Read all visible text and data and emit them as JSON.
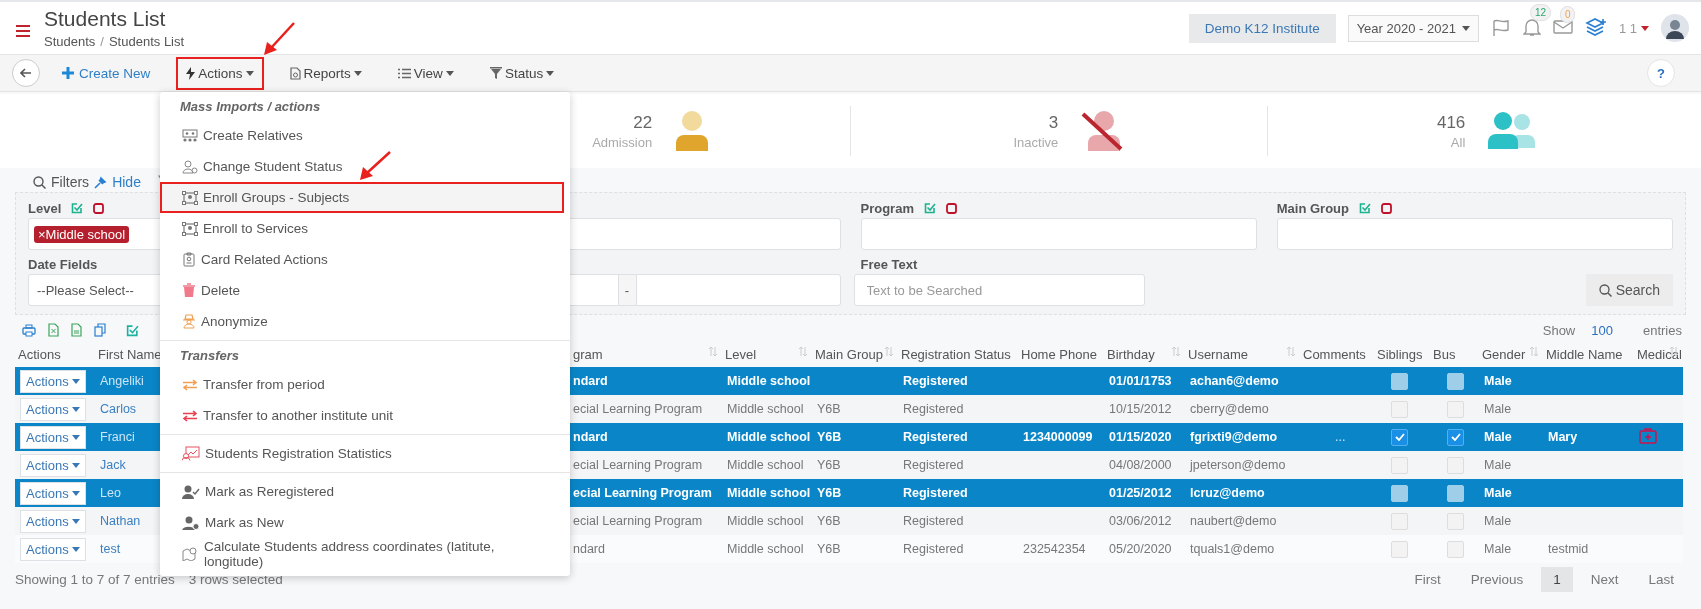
{
  "header": {
    "title": "Students List",
    "breadcrumb": [
      "Students",
      "Students List"
    ],
    "breadcrumb_separator": "/",
    "institute": "Demo K12 Institute",
    "year": "Year 2020 - 2021",
    "notifications": "12",
    "messages": "0",
    "user": "1 1"
  },
  "toolbar": {
    "items": [
      {
        "kind": "create",
        "label": "Create New",
        "marked": false
      },
      {
        "kind": "actions",
        "label": "Actions",
        "marked": true
      },
      {
        "kind": "reports",
        "label": "Reports",
        "marked": false
      },
      {
        "kind": "view",
        "label": "View",
        "marked": false
      },
      {
        "kind": "status",
        "label": "Status",
        "marked": false
      }
    ],
    "help": "?"
  },
  "stats": [
    {
      "kind": "admission",
      "value": "22",
      "label": "Admission"
    },
    {
      "kind": "inactive",
      "value": "3",
      "label": "Inactive"
    },
    {
      "kind": "all",
      "value": "416",
      "label": "All"
    }
  ],
  "filters": {
    "title": "Filters",
    "hide": "Hide",
    "level": {
      "label": "Level",
      "tag_remove": "×",
      "tag": "Middle school"
    },
    "program": {
      "label": "Program"
    },
    "main_group": {
      "label": "Main Group"
    },
    "date_fields": {
      "label": "Date Fields",
      "value": "--Please Select--"
    },
    "date_separator": "-",
    "free_text": {
      "label": "Free Text",
      "placeholder": "Text to be Searched"
    },
    "search": "Search"
  },
  "table": {
    "show": "Show",
    "page_size": "100",
    "entries": "entries",
    "columns": [
      {
        "label": "Actions",
        "sortable": false
      },
      {
        "label": "First Name"
      },
      {
        "label": "gram",
        "sortable": true
      },
      {
        "label": "Level",
        "sortable": true
      },
      {
        "label": "Main Group",
        "sortable": true
      },
      {
        "label": "Registration Status",
        "sortable": false
      },
      {
        "label": "Home Phone",
        "sortable": false
      },
      {
        "label": "Birthday",
        "sortable": true
      },
      {
        "label": "Username",
        "sortable": true
      },
      {
        "label": "Comments",
        "sortable": false
      },
      {
        "label": "Siblings",
        "sortable": false
      },
      {
        "label": "Bus",
        "sortable": false
      },
      {
        "label": "Gender",
        "sortable": true
      },
      {
        "label": "Middle Name",
        "sortable": false
      },
      {
        "label": "Medical",
        "sortable": true
      }
    ],
    "rows": [
      {
        "selected": true,
        "action": "Actions",
        "first_name": "Angeliki",
        "program": "ndard",
        "level": "Middle school",
        "status": "Registered",
        "birthday": "01/01/1753",
        "username": "achan6@demo",
        "siblings": false,
        "bus": false,
        "gender": "Male",
        "medical": false
      },
      {
        "selected": false,
        "action": "Actions",
        "first_name": "Carlos",
        "program": "ecial Learning Program",
        "level": "Middle school",
        "main_group": "Y6B",
        "status": "Registered",
        "birthday": "10/15/2012",
        "username": "cberry@demo",
        "siblings": false,
        "bus": false,
        "gender": "Male",
        "medical": false
      },
      {
        "selected": true,
        "action": "Actions",
        "first_name": "Franci",
        "program": "ndard",
        "level": "Middle school",
        "main_group": "Y6B",
        "status": "Registered",
        "phone": "1234000099",
        "birthday": "01/15/2020",
        "username": "fgrixti9@demo",
        "comments": "...",
        "siblings": true,
        "bus": true,
        "gender": "Male",
        "middle_name": "Mary",
        "medical": true
      },
      {
        "selected": false,
        "action": "Actions",
        "first_name": "Jack",
        "program": "ecial Learning Program",
        "level": "Middle school",
        "main_group": "Y6B",
        "status": "Registered",
        "birthday": "04/08/2000",
        "username": "jpeterson@demo",
        "siblings": false,
        "bus": false,
        "gender": "Male",
        "medical": false
      },
      {
        "selected": true,
        "action": "Actions",
        "first_name": "Leo",
        "program": "ecial Learning Program",
        "level": "Middle school",
        "main_group": "Y6B",
        "status": "Registered",
        "birthday": "01/25/2012",
        "username": "lcruz@demo",
        "siblings": false,
        "bus": false,
        "gender": "Male",
        "medical": false
      },
      {
        "selected": false,
        "action": "Actions",
        "first_name": "Nathan",
        "program": "ecial Learning Program",
        "level": "Middle school",
        "main_group": "Y6B",
        "status": "Registered",
        "birthday": "03/06/2012",
        "username": "naubert@demo",
        "siblings": false,
        "bus": false,
        "gender": "Male",
        "medical": false
      },
      {
        "selected": false,
        "action": "Actions",
        "first_name": "test",
        "program": "ndard",
        "level": "Middle school",
        "main_group": "Y6B",
        "status": "Registered",
        "phone": "232542354",
        "birthday": "05/20/2020",
        "username": "tquals1@demo",
        "siblings": false,
        "bus": false,
        "gender": "Male",
        "middle_name": "testmid",
        "medical": false
      }
    ],
    "info": "Showing 1 to 7 of 7 entries",
    "selection_info": "3 rows selected",
    "pagination": [
      {
        "label": "First",
        "selected": false
      },
      {
        "label": "Previous",
        "selected": false
      },
      {
        "label": "1",
        "selected": true
      },
      {
        "label": "Next",
        "selected": false
      },
      {
        "label": "Last",
        "selected": false
      }
    ]
  },
  "actions_menu": {
    "sections": [
      {
        "title": "Mass Imports / actions",
        "items": [
          {
            "kind": "relatives",
            "label": "Create Relatives",
            "marked": false
          },
          {
            "kind": "status",
            "label": "Change Student Status",
            "marked": false
          },
          {
            "kind": "enroll",
            "label": "Enroll Groups - Subjects",
            "marked": true
          },
          {
            "kind": "enroll",
            "label": "Enroll to Services",
            "marked": false
          },
          {
            "kind": "card",
            "label": "Card Related Actions",
            "marked": false
          },
          {
            "kind": "delete",
            "label": "Delete",
            "marked": false
          },
          {
            "kind": "anonymize",
            "label": "Anonymize",
            "marked": false
          }
        ]
      },
      {
        "title": "Transfers",
        "items": [
          {
            "kind": "transfer",
            "label": "Transfer from period",
            "marked": false
          },
          {
            "kind": "transfer-unit",
            "label": "Transfer to another institute unit",
            "marked": false
          }
        ]
      },
      {
        "items": [
          {
            "kind": "statistics",
            "label": "Students Registration Statistics",
            "marked": false
          }
        ]
      },
      {
        "items": [
          {
            "kind": "reregister",
            "label": "Mark as Reregistered",
            "marked": false
          },
          {
            "kind": "new",
            "label": "Mark as New",
            "marked": false
          },
          {
            "kind": "geo",
            "label": "Calculate Students address coordinates (latitute, longitude)",
            "marked": false
          }
        ]
      }
    ]
  }
}
